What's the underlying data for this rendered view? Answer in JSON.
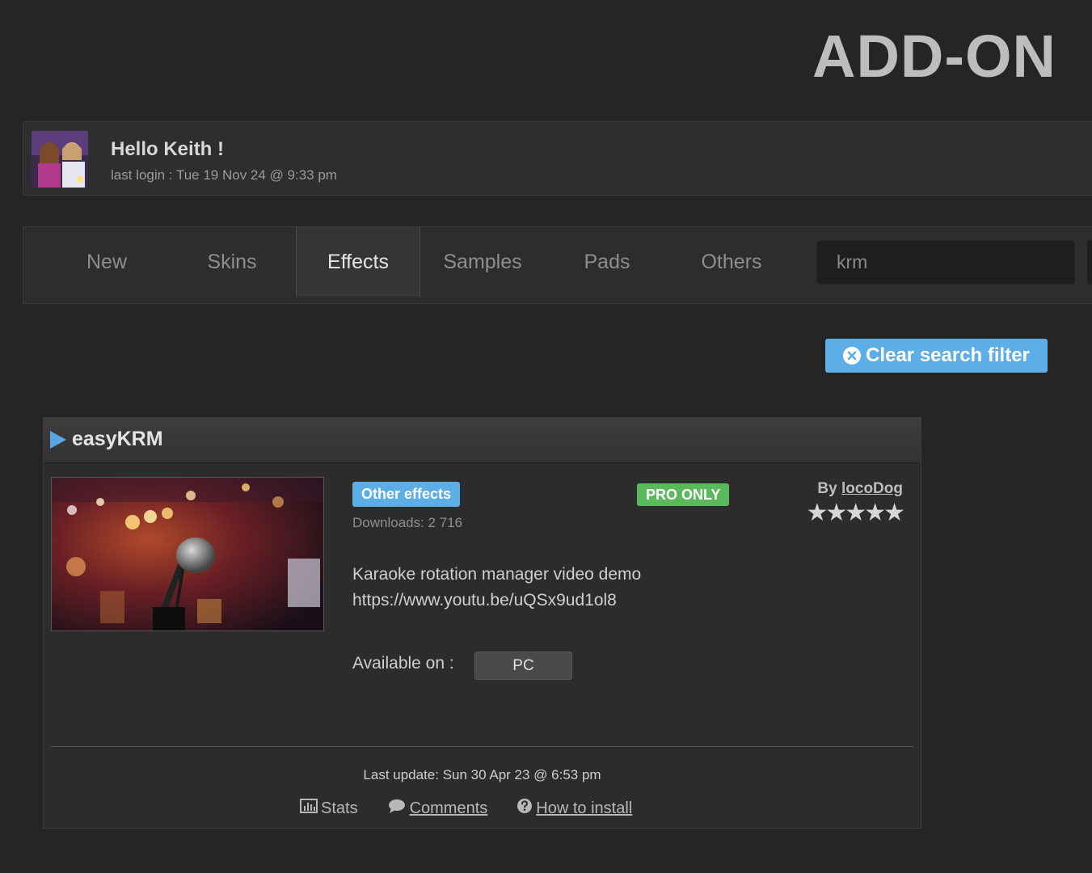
{
  "page": {
    "title": "ADD-ON"
  },
  "user": {
    "greeting": "Hello Keith !",
    "last_login": "last login : Tue 19 Nov 24 @ 9:33 pm"
  },
  "tabs": [
    {
      "label": "New"
    },
    {
      "label": "Skins"
    },
    {
      "label": "Effects",
      "active": true
    },
    {
      "label": "Samples"
    },
    {
      "label": "Pads"
    },
    {
      "label": "Others"
    }
  ],
  "search": {
    "value": "krm"
  },
  "clear_filter": {
    "label": "Clear search filter",
    "icon": "close-circle-icon"
  },
  "addon": {
    "name": "easyKRM",
    "category": "Other effects",
    "badge": "PRO ONLY",
    "downloads": "Downloads: 2 716",
    "author_prefix": "By",
    "author": "locoDog",
    "rating": 5,
    "stars": "★★★★★",
    "description_line1": "Karaoke rotation manager video demo",
    "description_line2": "https://www.youtu.be/uQSx9ud1ol8",
    "available_label": "Available on :",
    "platform": "PC",
    "last_update": "Last update: Sun 30 Apr 23 @ 6:53 pm",
    "links": {
      "stats": "Stats",
      "comments": "Comments",
      "how_to_install": "How to install"
    }
  },
  "colors": {
    "accent_blue": "#5dade7",
    "pro_green": "#5cb85c",
    "background": "#252525"
  }
}
